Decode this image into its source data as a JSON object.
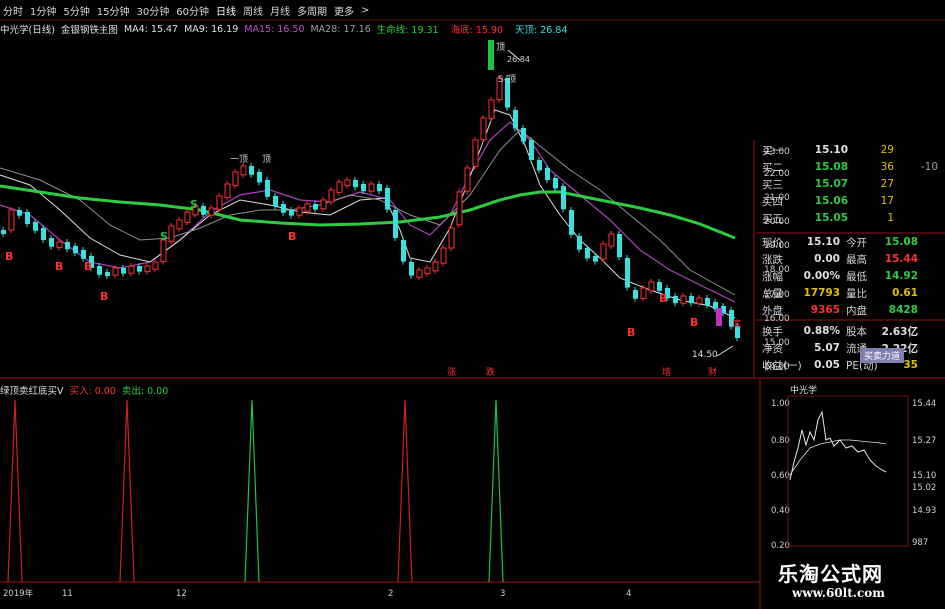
{
  "toolbar": {
    "items": [
      "分时",
      "1分钟",
      "5分钟",
      "15分钟",
      "30分钟",
      "60分钟",
      "日线",
      "周线",
      "月线",
      "多周期",
      "更多"
    ]
  },
  "main_indicator": {
    "stock": "中光学(日线)",
    "formula": "金银钢铁主图",
    "ma4": "MA4: 15.47",
    "ma9": "MA9: 16.19",
    "ma15": "MA15: 16.50",
    "ma28": "MA28: 17.16",
    "lifeline": "生命线: 19.31",
    "haidi": "海底: 15.90",
    "tianding": "天顶: 26.84"
  },
  "price_axis": [
    "23.00",
    "22.00",
    "21.00",
    "20.00",
    "19.00",
    "18.00",
    "17.00",
    "16.00",
    "15.00",
    "14.00"
  ],
  "annotations": {
    "top_label": "顶",
    "peak_value": "26.84",
    "s_top": "S-顶",
    "mid_top": "一顶",
    "s_mark": "S",
    "b_mark": "B",
    "low_value": "14.50",
    "low_right": "底",
    "bottom_tags": [
      "涨",
      "跌",
      "增",
      "财"
    ]
  },
  "quote": {
    "bids": [
      {
        "label": "买一",
        "price": "15.10",
        "vol": "29",
        "extra": ""
      },
      {
        "label": "买二",
        "price": "15.08",
        "vol": "36",
        "extra": "-10"
      },
      {
        "label": "买三",
        "price": "15.07",
        "vol": "27",
        "extra": ""
      },
      {
        "label": "买四",
        "price": "15.06",
        "vol": "17",
        "extra": ""
      },
      {
        "label": "买五",
        "price": "15.05",
        "vol": "1",
        "extra": ""
      }
    ],
    "stats": [
      {
        "l1": "现价",
        "v1": "15.10",
        "l2": "今开",
        "v2": "15.08"
      },
      {
        "l1": "涨跌",
        "v1": "0.00",
        "l2": "最高",
        "v2": "15.44"
      },
      {
        "l1": "涨幅",
        "v1": "0.00%",
        "l2": "最低",
        "v2": "14.92"
      },
      {
        "l1": "总量",
        "v1": "17793",
        "l2": "量比",
        "v2": "0.61"
      },
      {
        "l1": "外盘",
        "v1": "9365",
        "l2": "内盘",
        "v2": "8428"
      },
      {
        "l1": "换手",
        "v1": "0.88%",
        "l2": "股本",
        "v2": "2.63亿"
      },
      {
        "l1": "净资",
        "v1": "5.07",
        "l2": "流通",
        "v2": "2.22亿"
      },
      {
        "l1": "收益(一)",
        "v1": "0.05",
        "l2": "PE(动)",
        "v2": "35"
      }
    ],
    "badge": "买卖力道"
  },
  "sub_indicator": {
    "name": "绿顶卖红底买V",
    "buy": "买入: 0.00",
    "sell": "卖出: 0.00",
    "axis": [
      "1.00",
      "0.80",
      "0.60",
      "0.40",
      "0.20"
    ]
  },
  "date_axis": [
    "2019年",
    "11",
    "12",
    "2",
    "3",
    "4"
  ],
  "mini_chart": {
    "title": "中光学",
    "right_axis": [
      "15.44",
      "15.27",
      "15.10",
      "15.02",
      "14.93"
    ],
    "left_axis": [
      "1.00",
      "0.80",
      "0.60",
      "0.40",
      "0.20"
    ],
    "volume": "987"
  },
  "watermark": {
    "line1": "乐淘公式网",
    "line2": "www.60lt.com"
  },
  "colors": {
    "up": "#ff3030",
    "down": "#38e0e0",
    "lifeline": "#2ecc40",
    "ma_purple": "#b040c0",
    "ma_white": "#e0e0e0",
    "frame": "#9a1010",
    "buy_signal": "#d02020",
    "sell_signal": "#20c040"
  }
}
